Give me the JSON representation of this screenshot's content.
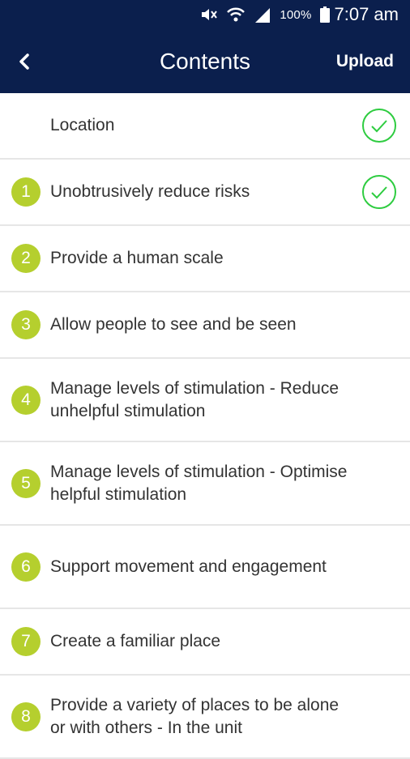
{
  "status_bar": {
    "battery": "100%",
    "time": "7:07 am",
    "icons": [
      "mute-icon",
      "wifi-icon",
      "signal-icon",
      "battery-icon"
    ]
  },
  "header": {
    "title": "Contents",
    "upload_label": "Upload",
    "back_icon": "chevron-left-icon",
    "color": "#0b1f4d"
  },
  "accent": {
    "badge": "#b5cf2e",
    "check": "#2ecc40"
  },
  "items": [
    {
      "number": "",
      "label": "Location",
      "completed": true
    },
    {
      "number": "1",
      "label": "Unobtrusively reduce risks",
      "completed": true
    },
    {
      "number": "2",
      "label": "Provide a human scale",
      "completed": false
    },
    {
      "number": "3",
      "label": "Allow people to see and be seen",
      "completed": false
    },
    {
      "number": "4",
      "label": "Manage levels of stimulation - Reduce unhelpful stimulation",
      "completed": false
    },
    {
      "number": "5",
      "label": "Manage levels of stimulation - Optimise helpful stimulation",
      "completed": false
    },
    {
      "number": "6",
      "label": "Support movement and engagement",
      "completed": false
    },
    {
      "number": "7",
      "label": "Create a familiar place",
      "completed": false
    },
    {
      "number": "8",
      "label": "Provide a variety of places to be alone or with others - In the unit",
      "completed": false
    }
  ]
}
